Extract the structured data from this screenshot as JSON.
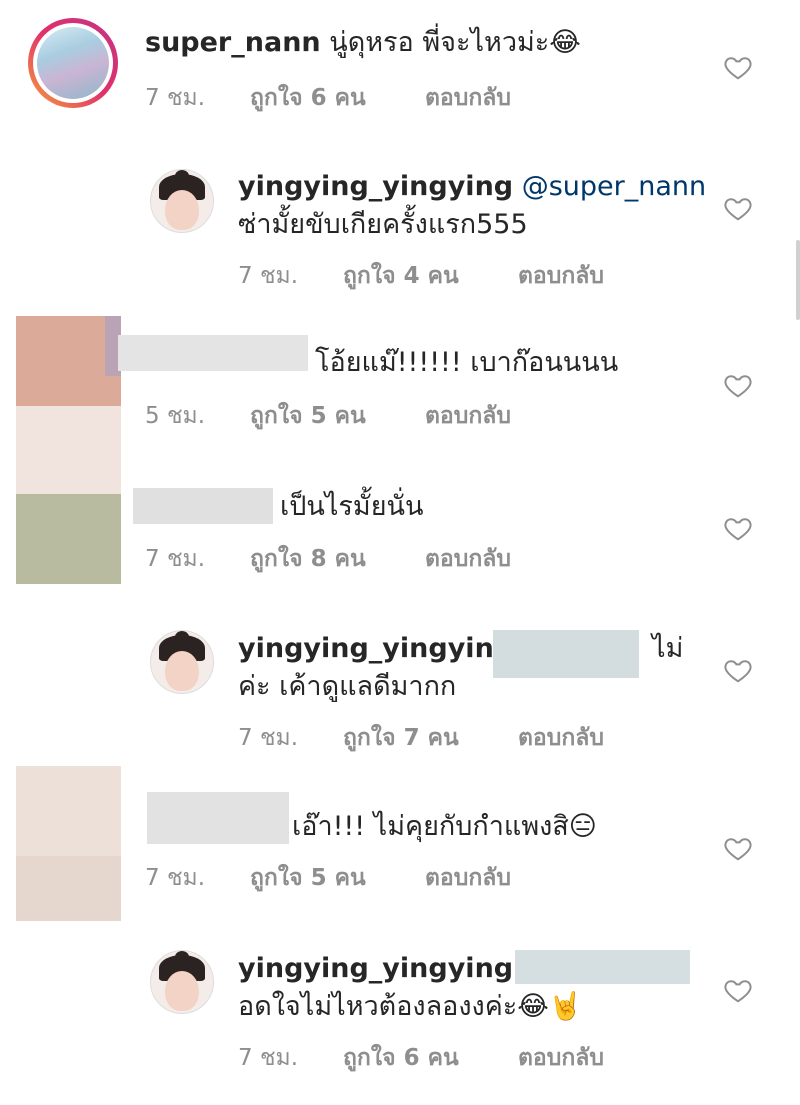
{
  "comments": [
    {
      "user": "super_nann",
      "mention": "",
      "text": "นู่ดุหรอ พี่จะไหวม่ะ😂",
      "text2": "",
      "time": "7 ชม.",
      "likes": "ถูกใจ 6 คน",
      "reply": "ตอบกลับ"
    },
    {
      "user": "yingying_yingying",
      "mention": "@super_nann",
      "text": "",
      "text2": "ซ่ามั้ยขับเกียครั้งแรก555",
      "time": "7 ชม.",
      "likes": "ถูกใจ 4 คน",
      "reply": "ตอบกลับ"
    },
    {
      "user": "",
      "mention": "",
      "text": "โอ้ยแม๊!!!!!! เบาก๊อนนนน",
      "text2": "",
      "time": "5 ชม.",
      "likes": "ถูกใจ 5 คน",
      "reply": "ตอบกลับ"
    },
    {
      "user": "",
      "mention": "",
      "text": "เป็นไรมั้ยนั่น",
      "text2": "",
      "time": "7 ชม.",
      "likes": "ถูกใจ 8 คน",
      "reply": "ตอบกลับ"
    },
    {
      "user": "yingying_yingying",
      "mention": "",
      "text": "ไม่",
      "text2": "ค่ะ เค้าดูแลดีมากก",
      "time": "7 ชม.",
      "likes": "ถูกใจ 7 คน",
      "reply": "ตอบกลับ"
    },
    {
      "user": "",
      "mention": "",
      "text": "เอ๊า!!! ไม่คุยกับกำแพงสิ😑",
      "text2": "",
      "time": "7 ชม.",
      "likes": "ถูกใจ 5 คน",
      "reply": "ตอบกลับ"
    },
    {
      "user": "yingying_yingying",
      "mention": "@",
      "text": "",
      "text2": "อดใจไม่ไหวต้องลองงค่ะ😂🤘",
      "time": "7 ชม.",
      "likes": "ถูกใจ 6 คน",
      "reply": "ตอบกลับ"
    }
  ],
  "colors": {
    "username": "#262626",
    "mention": "#00376b",
    "meta": "#8e8e8e",
    "ring_start": "#f6a13a",
    "ring_end": "#c13584"
  },
  "icons": {
    "like": "heart-outline-icon"
  }
}
